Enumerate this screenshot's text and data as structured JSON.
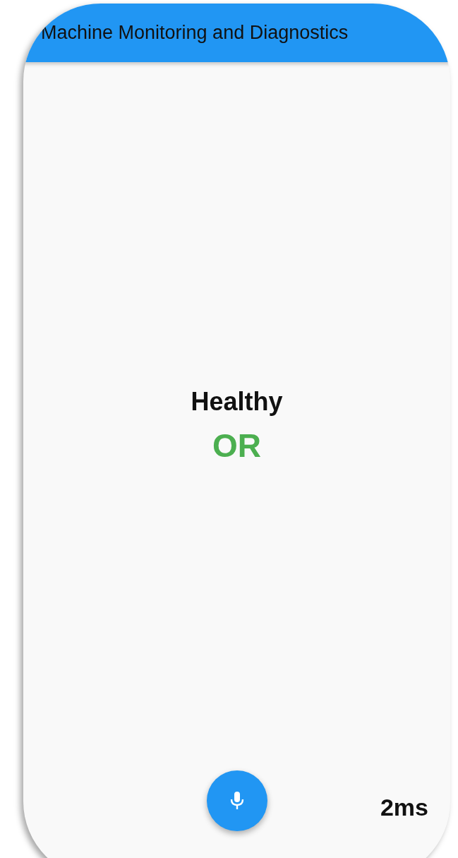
{
  "app_bar": {
    "title": "Machine Monitoring and Diagnostics"
  },
  "status": {
    "label": "Healthy",
    "result": "OR"
  },
  "latency": "2ms"
}
